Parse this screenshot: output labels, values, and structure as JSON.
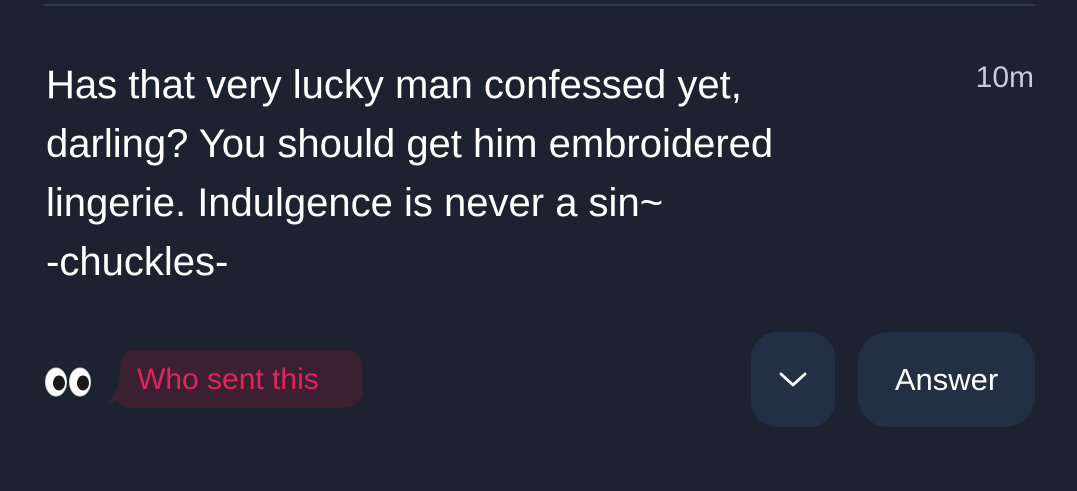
{
  "question": {
    "text": "Has that very lucky man confessed yet,\ndarling? You should get him embroidered\nlingerie. Indulgence is never a sin~\n-chuckles-",
    "timestamp": "10m"
  },
  "actions": {
    "reaction_icon": "eyes-emoji-icon",
    "who_sent_label": "Who sent this",
    "who_sent_color": "#e0245e",
    "expand_icon": "chevron-down-icon",
    "answer_label": "Answer"
  },
  "colors": {
    "background": "#1c2230",
    "button_background": "#232f45",
    "who_sent_background": "#3a2030"
  }
}
